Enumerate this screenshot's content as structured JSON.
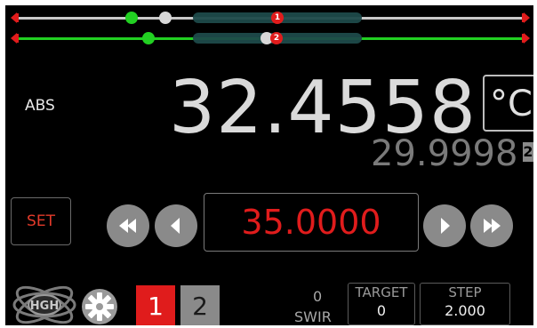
{
  "sliders": [
    {
      "marker": "1",
      "line_color": "#c8c8c8"
    },
    {
      "marker": "2",
      "line_color": "#22d022"
    }
  ],
  "mode_label": "ABS",
  "main_value": "32.4558",
  "unit": "°C",
  "secondary_value": "29.9998",
  "secondary_channel": "2",
  "set_label": "SET",
  "setpoint_value": "35.0000",
  "logo_text": "HGH",
  "channels": [
    "1",
    "2"
  ],
  "active_channel": "1",
  "swir": {
    "value": "0",
    "label": "SWIR"
  },
  "target": {
    "label": "TARGET",
    "value": "0"
  },
  "step": {
    "label": "STEP",
    "value": "2.000"
  },
  "colors": {
    "accent_red": "#e01c1c",
    "green": "#22d022",
    "gray": "#8a8a8a"
  }
}
